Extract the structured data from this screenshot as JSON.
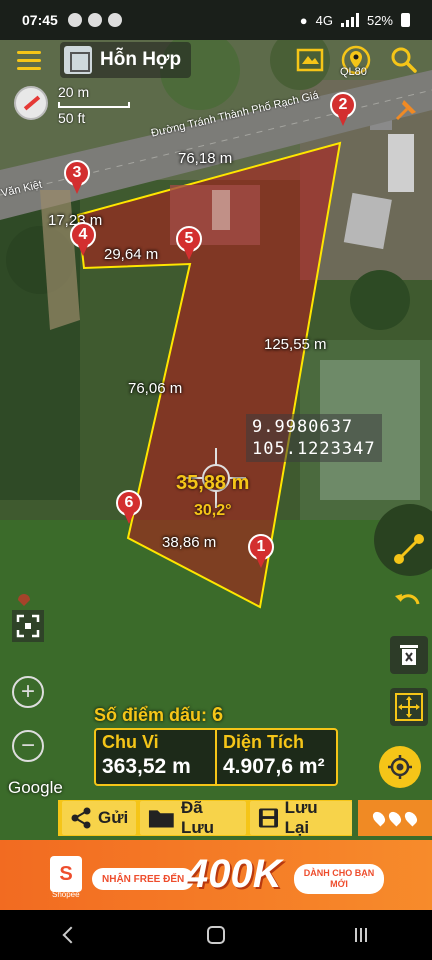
{
  "status_bar": {
    "time": "07:45",
    "battery": "52%",
    "network": "4G"
  },
  "top_bar": {
    "map_type": "Hỗn Hợp"
  },
  "scale": {
    "metric": "20 m",
    "imperial": "50 ft"
  },
  "roads": {
    "main": "Đường Tránh Thành Phố Rạch Giá",
    "left": "Văn Kiệt",
    "right": "QL80"
  },
  "measurements": {
    "seg_3_2": "76,18 m",
    "seg_3_4": "17,23 m",
    "seg_4_5": "29,64 m",
    "seg_2_1": "125,55 m",
    "seg_5_6": "76,06 m",
    "seg_6_1": "38,86 m",
    "current": "35,88 m",
    "angle": "30,2°"
  },
  "points": [
    "1",
    "2",
    "3",
    "4",
    "5",
    "6"
  ],
  "coordinates": {
    "lat": "9.9980637",
    "lng": "105.1223347"
  },
  "summary": {
    "count_label": "Số điểm dấu:",
    "count_value": "6",
    "perimeter_label": "Chu Vi",
    "perimeter_value": "363,52 m",
    "area_label": "Diện Tích",
    "area_value": "4.907,6 m²"
  },
  "attribution": "Google",
  "actions": {
    "send": "Gửi",
    "saved": "Đã Lưu",
    "save": "Lưu Lại"
  },
  "ad": {
    "brand": "S",
    "brand_caption": "Shopee",
    "promo_left": "NHẬN FREE ĐẾN",
    "amount": "400K",
    "promo_right": "DÀNH CHO BẠN MỚI"
  },
  "colors": {
    "accent": "#f5c518",
    "polygon_fill": "#b71c1c",
    "pin": "#d32f2f",
    "ad": "#f26b21"
  },
  "icons": [
    "menu-icon",
    "layers-icon",
    "map-type-icon",
    "location-marker-icon",
    "search-icon",
    "compass-icon",
    "pin-add-icon",
    "polyline-icon",
    "undo-icon",
    "delete-icon",
    "expand-icon",
    "focus-icon",
    "zoom-in-icon",
    "zoom-out-icon",
    "gps-icon",
    "share-icon",
    "folder-icon",
    "save-icon"
  ]
}
